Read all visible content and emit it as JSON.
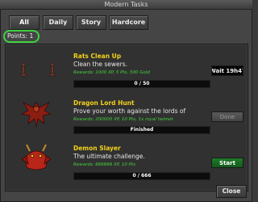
{
  "window": {
    "title": "Modern Tasks"
  },
  "tabs": [
    {
      "label": "All",
      "active": true
    },
    {
      "label": "Daily",
      "active": false
    },
    {
      "label": "Story",
      "active": false
    },
    {
      "label": "Hardcore",
      "active": false
    }
  ],
  "points_label": "Points: 1",
  "tasks": [
    {
      "icon": "statues-icon",
      "title": "Rats Clean Up",
      "description": "Clean the sewers.",
      "rewards": "Rewards: 1000 XP, 5 Pts, 500 Gold",
      "progress_text": "0 / 50",
      "progress": 0,
      "action": "Wait 19h47m"
    },
    {
      "icon": "dragon-lord-icon",
      "title": "Dragon Lord Hunt",
      "description": "Prove your worth against the lords of",
      "rewards": "Rewards: 200000 XP, 10 Pts, 1x royal helmet",
      "progress_text": "Finished",
      "progress": 1,
      "action": "Done"
    },
    {
      "icon": "demon-icon",
      "title": "Demon Slayer",
      "description": "The ultimate challenge.",
      "rewards": "Rewards: 666666 XP, 10 Pts",
      "progress_text": "0 / 666",
      "progress": 0,
      "action": "Start"
    }
  ],
  "close_label": "Close",
  "colors": {
    "title": "#f2d21a",
    "reward": "#44d03c",
    "points_highlight": "#3fd23f",
    "start_button": "#1f7a2a"
  }
}
